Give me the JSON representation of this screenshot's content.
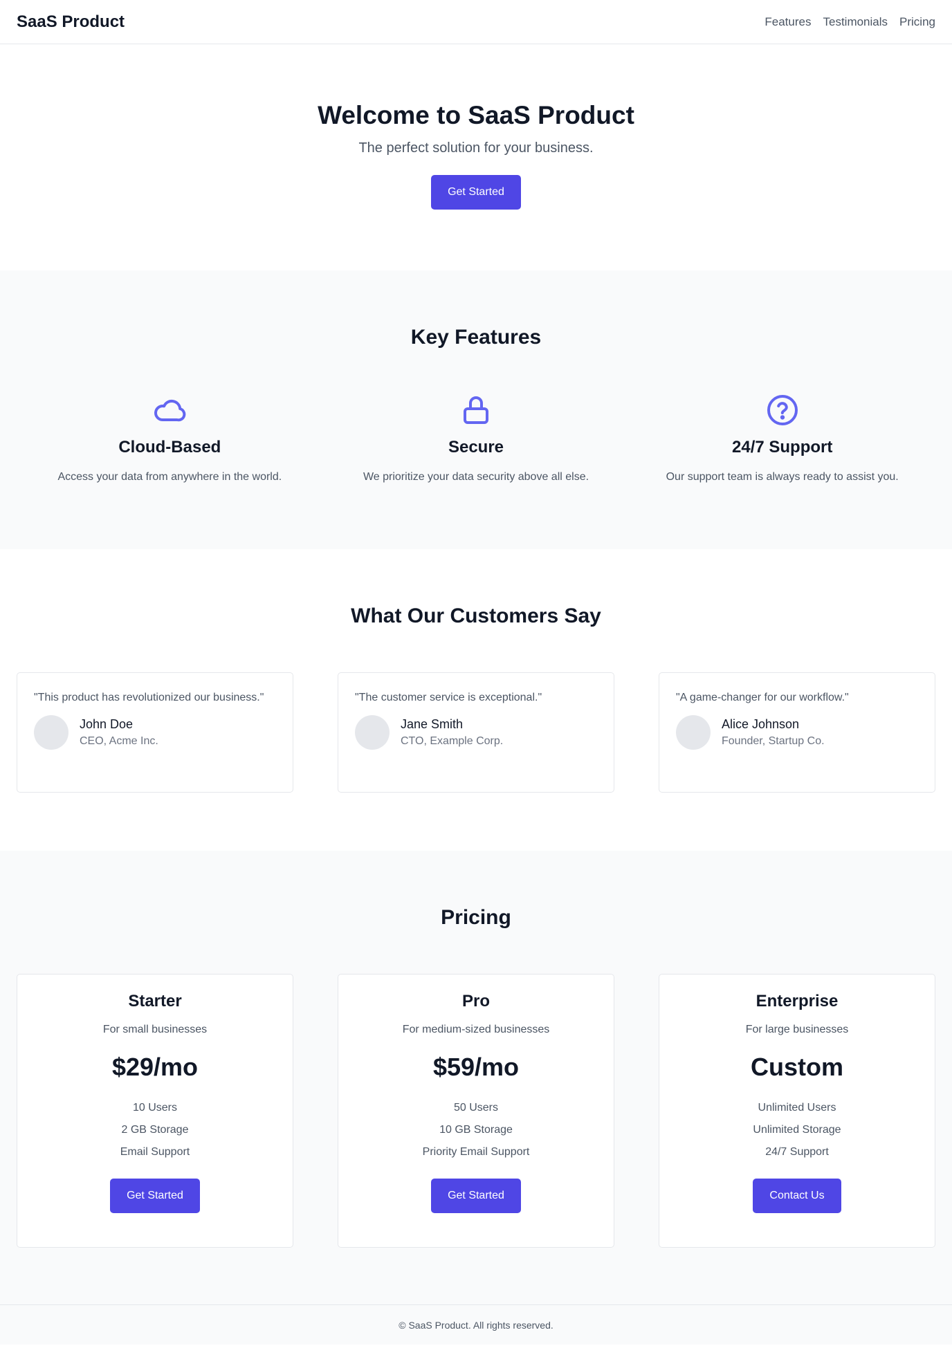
{
  "header": {
    "logo": "SaaS Product",
    "nav": [
      "Features",
      "Testimonials",
      "Pricing"
    ]
  },
  "hero": {
    "title": "Welcome to SaaS Product",
    "subtitle": "The perfect solution for your business.",
    "cta": "Get Started"
  },
  "features": {
    "title": "Key Features",
    "items": [
      {
        "icon": "cloud-icon",
        "title": "Cloud-Based",
        "desc": "Access your data from anywhere in the world."
      },
      {
        "icon": "lock-icon",
        "title": "Secure",
        "desc": "We prioritize your data security above all else."
      },
      {
        "icon": "question-circle-icon",
        "title": "24/7 Support",
        "desc": "Our support team is always ready to assist you."
      }
    ]
  },
  "testimonials": {
    "title": "What Our Customers Say",
    "items": [
      {
        "quote": "\"This product has revolutionized our business.\"",
        "name": "John Doe",
        "role": "CEO, Acme Inc."
      },
      {
        "quote": "\"The customer service is exceptional.\"",
        "name": "Jane Smith",
        "role": "CTO, Example Corp."
      },
      {
        "quote": "\"A game-changer for our workflow.\"",
        "name": "Alice Johnson",
        "role": "Founder, Startup Co."
      }
    ]
  },
  "pricing": {
    "title": "Pricing",
    "plans": [
      {
        "name": "Starter",
        "desc": "For small businesses",
        "price": "$29/mo",
        "features": [
          "10 Users",
          "2 GB Storage",
          "Email Support"
        ],
        "cta": "Get Started"
      },
      {
        "name": "Pro",
        "desc": "For medium-sized businesses",
        "price": "$59/mo",
        "features": [
          "50 Users",
          "10 GB Storage",
          "Priority Email Support"
        ],
        "cta": "Get Started"
      },
      {
        "name": "Enterprise",
        "desc": "For large businesses",
        "price": "Custom",
        "features": [
          "Unlimited Users",
          "Unlimited Storage",
          "24/7 Support"
        ],
        "cta": "Contact Us"
      }
    ]
  },
  "footer": {
    "text": "© SaaS Product. All rights reserved."
  },
  "colors": {
    "accent": "#4f46e5",
    "icon": "#6366f1",
    "text": "#111827",
    "muted": "#4b5563",
    "section_bg": "#f9fafb"
  }
}
